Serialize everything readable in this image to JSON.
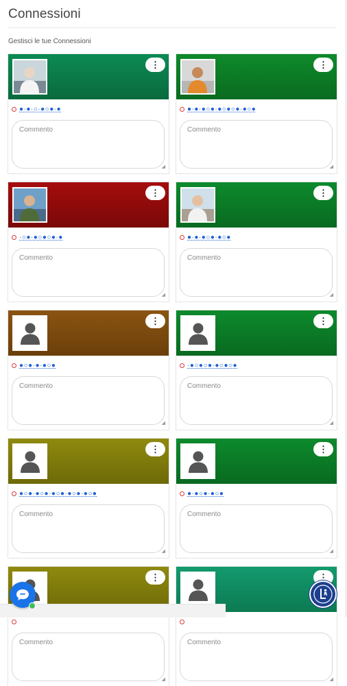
{
  "page": {
    "title": "Connessioni",
    "subtitle": "Gestisci le tue Connessioni"
  },
  "card_common": {
    "menu_icon": "⋮",
    "comment_placeholder": "Commento",
    "resize_grip": "◢"
  },
  "cards": [
    {
      "name": "●·●·○·●○●·●",
      "banner_colors": [
        "#0c8a55",
        "#0a6a3d"
      ],
      "avatar": "photo-two-people",
      "status": "offline"
    },
    {
      "name": "●·●·●○●·●○●○●·●○●",
      "banner_colors": [
        "#0e8a2a",
        "#0a6b20"
      ],
      "avatar": "photo-person-basketball",
      "status": "offline"
    },
    {
      "name": "·○●·●○●○●·●",
      "banner_colors": [
        "#a50d0d",
        "#7a0808"
      ],
      "avatar": "photo-person-outdoor",
      "status": "offline"
    },
    {
      "name": "●·●·●○●·●○●",
      "banner_colors": [
        "#0d8a2c",
        "#096a20"
      ],
      "avatar": "photo-person-cap",
      "status": "offline"
    },
    {
      "name": "●○●·●·●○●",
      "banner_colors": [
        "#8a5412",
        "#6b3f0a"
      ],
      "avatar": "default-user",
      "status": "offline"
    },
    {
      "name": "·●○●○●·●○●○●",
      "banner_colors": [
        "#0d8a2c",
        "#096a20"
      ],
      "avatar": "default-user",
      "status": "offline"
    },
    {
      "name": "●○●·●○●·●○●·●○●·●○●",
      "banner_colors": [
        "#8f8a0e",
        "#6e6a08"
      ],
      "avatar": "default-user",
      "status": "offline"
    },
    {
      "name": "●·●○●·●○●",
      "banner_colors": [
        "#0d8a2c",
        "#096a20"
      ],
      "avatar": "default-user",
      "status": "offline"
    },
    {
      "name": "",
      "banner_colors": [
        "#8f8a0e",
        "#6e6a08"
      ],
      "avatar": "default-user",
      "status": "offline"
    },
    {
      "name": "",
      "banner_colors": [
        "#139a6e",
        "#0d7a52"
      ],
      "avatar": "default-user",
      "status": "offline"
    }
  ],
  "widgets": {
    "chat_icon": "chat-bubble-icon",
    "logo_icon": "club-logo-icon"
  },
  "colors": {
    "status_offline": "#d83a3a",
    "link": "#1f5fd6",
    "chat_fab": "#1a73e8",
    "logo_fab": "#1d3f8f"
  }
}
